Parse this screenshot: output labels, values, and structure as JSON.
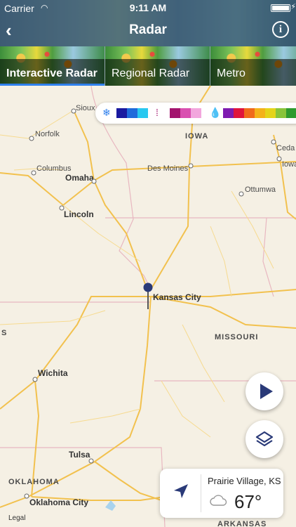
{
  "status": {
    "carrier": "Carrier",
    "time": "9:11 AM"
  },
  "nav": {
    "title": "Radar"
  },
  "tabs": [
    {
      "label": "Interactive Radar",
      "active": true
    },
    {
      "label": "Regional Radar",
      "active": false
    },
    {
      "label": "Metro",
      "active": false
    }
  ],
  "legend": {
    "snow_colors": [
      "#1a1aa0",
      "#1f6bdb",
      "#28c8f0"
    ],
    "mix_colors": [
      "#a3146e",
      "#d94fb0",
      "#f2a6dd"
    ],
    "rain_colors": [
      "#7e1bb0",
      "#e0143c",
      "#f06a1b",
      "#f4b21a",
      "#e4d41a",
      "#88c43a",
      "#2e9a2e"
    ]
  },
  "map": {
    "cities": {
      "sioux_city": "Sioux City",
      "norfolk": "Norfolk",
      "columbus": "Columbus",
      "omaha": "Omaha",
      "lincoln": "Lincoln",
      "des_moines": "Des Moines",
      "ottumwa": "Ottumwa",
      "cedar": "Ceda",
      "iowa_city": "Iowa",
      "kansas_city": "Kansas City",
      "wichita": "Wichita",
      "tulsa": "Tulsa",
      "oklahoma_city": "Oklahoma City"
    },
    "states": {
      "iowa": "IOWA",
      "missouri": "MISSOURI",
      "oklahoma": "OKLAHOMA",
      "arkansas": "ARKANSAS",
      "kansas_fragment": "S"
    },
    "legal": "Legal"
  },
  "weather": {
    "place": "Prairie Village, KS",
    "temp": "67°"
  },
  "icons": [
    "back-icon",
    "info-icon",
    "snow-icon",
    "mix-icon",
    "rain-drop-icon",
    "play-icon",
    "layers-icon",
    "location-arrow-icon",
    "cloud-icon",
    "map-pin-icon"
  ]
}
